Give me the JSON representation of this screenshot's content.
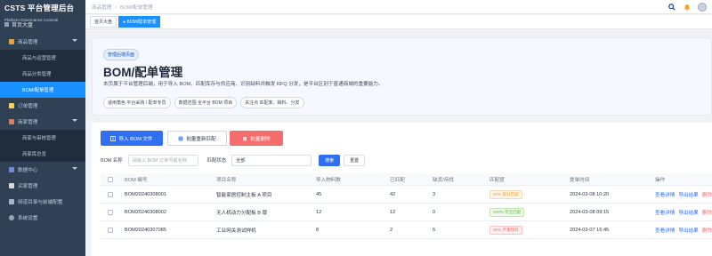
{
  "sidebar": {
    "brand_title": "CSTS 平台管理后台",
    "brand_sub": "Platform Governance Console",
    "home_label": "首页大盘",
    "groups": [
      {
        "label": "商品管理",
        "expanded": true
      },
      {
        "label": "订单管理"
      },
      {
        "label": "商家管理",
        "expanded": true
      },
      {
        "label": "数据中心"
      },
      {
        "label": "买家管理"
      },
      {
        "label": "频道目录与前端配置"
      },
      {
        "label": "系统设置"
      }
    ],
    "goods_sub": [
      "商品与运营管理",
      "商品分类管理",
      "BOM/配单管理"
    ],
    "merchant_sub": [
      "商家与审核管理",
      "商家库总览"
    ]
  },
  "topbar": {
    "breadcrumb": [
      "商品管理",
      "BOM/配单管理"
    ],
    "icons": [
      "search-icon",
      "bell-icon",
      "avatar"
    ]
  },
  "tags": [
    "首页大盘",
    "BOM/配单管理"
  ],
  "hero": {
    "badge": "管理后端页面",
    "title": "BOM/配单管理",
    "description": "本页属于平台管理后端，用于导入 BOM、匹配库存与供应商、识别缺料并触发 RFQ 分发，是平台区别于普通商城的重要能力。",
    "chips": [
      "适用角色  平台采购 / 配单专员",
      "数据范围  全平台 BOM 项目",
      "关注点  匹配率、缺料、分发"
    ]
  },
  "toolbar": {
    "import_label": "导入 BOM 文件",
    "rematch_label": "批量重新匹配",
    "delete_label": "批量删除"
  },
  "filter": {
    "bom_label": "BOM 名称",
    "bom_placeholder": "请输入 BOM 订单号或名称",
    "status_label": "匹配状态",
    "status_value": "全部",
    "search_label": "搜索",
    "reset_label": "重置"
  },
  "table": {
    "headers": [
      "BOM 编号",
      "项目名称",
      "导入物料数",
      "已匹配",
      "缺货/待找",
      "匹配度",
      "提单时间",
      "操作"
    ],
    "rows": [
      {
        "id": "BOM20240308001",
        "project": "智能家居控制主板 A 项目",
        "imported": "45",
        "matched": "42",
        "missing": "3",
        "rate": "93% 部分匹配",
        "rate_level": "warn",
        "time": "2024-03-08 10:20"
      },
      {
        "id": "BOM20240308002",
        "project": "无人机动力分配板 B 版",
        "imported": "12",
        "matched": "12",
        "missing": "0",
        "rate": "100% 完全匹配",
        "rate_level": "ok",
        "time": "2024-03-08 09:15"
      },
      {
        "id": "BOM20240307085",
        "project": "工业网关测试样机",
        "imported": "8",
        "matched": "2",
        "missing": "6",
        "rate": "25% 严重缺料",
        "rate_level": "danger",
        "time": "2024-03-07 16:45"
      }
    ],
    "actions": {
      "detail": "查看详情",
      "export": "导出结果",
      "delete": "删除"
    }
  }
}
